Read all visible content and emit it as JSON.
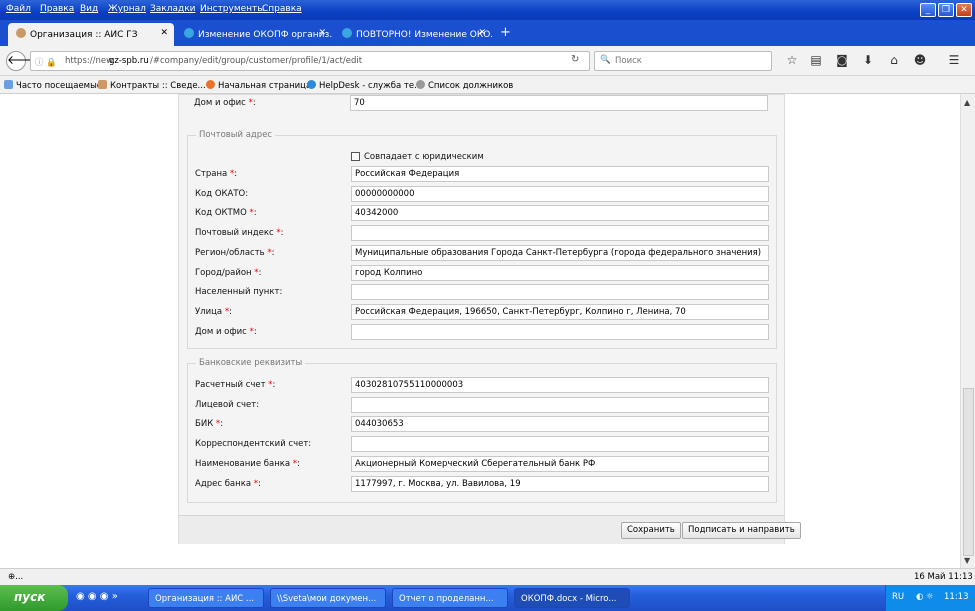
{
  "menu": [
    "Файл",
    "Правка",
    "Вид",
    "Журнал",
    "Закладки",
    "Инструменты",
    "Справка"
  ],
  "tabs": [
    {
      "label": "Организация :: АИС ГЗ",
      "active": true
    },
    {
      "label": "Изменение ОКОПФ организ...",
      "active": false
    },
    {
      "label": "ПОВТОРНО! Изменение ОКО...",
      "active": false
    }
  ],
  "new_tab": "+",
  "url": {
    "prefix": "https://new.",
    "domain": "gz-spb.ru",
    "path": "/#company/edit/group/customer/profile/1/act/edit"
  },
  "search": {
    "placeholder": "Поиск"
  },
  "bookmarks": [
    "Часто посещаемые",
    "Контракты :: Сведе...",
    "Начальная страница",
    "HelpDesk - служба те...",
    "Список должников"
  ],
  "top_row": {
    "label": "Дом и офис",
    "value": "70"
  },
  "postal": {
    "legend": "Почтовый адрес",
    "same_as_legal": "Совпадает с юридическим",
    "fields": [
      {
        "label": "Страна",
        "required": true,
        "value": "Российская Федерация"
      },
      {
        "label": "Код ОКАТО:",
        "required": false,
        "value": "00000000000"
      },
      {
        "label": "Код ОКТМО",
        "required": true,
        "value": "40342000"
      },
      {
        "label": "Почтовый индекс",
        "required": true,
        "value": ""
      },
      {
        "label": "Регион/область",
        "required": true,
        "value": "Муниципальные образования Города Санкт-Петербурга (города федерального значения)"
      },
      {
        "label": "Город/район",
        "required": true,
        "value": "город Колпино"
      },
      {
        "label": "Населенный пункт:",
        "required": false,
        "value": ""
      },
      {
        "label": "Улица",
        "required": true,
        "value": "Российская Федерация, 196650, Санкт-Петербург, Колпино г, Ленина, 70"
      },
      {
        "label": "Дом и офис",
        "required": true,
        "value": ""
      }
    ]
  },
  "bank": {
    "legend": "Банковские реквизиты",
    "fields": [
      {
        "label": "Расчетный счет",
        "required": true,
        "value": "40302810755110000003"
      },
      {
        "label": "Лицевой счет:",
        "required": false,
        "value": ""
      },
      {
        "label": "БИК",
        "required": true,
        "value": "044030653"
      },
      {
        "label": "Корреспондентский счет:",
        "required": false,
        "value": ""
      },
      {
        "label": "Наименование банка",
        "required": true,
        "value": "Акционерный Комерческий Сберегательный банк РФ"
      },
      {
        "label": "Адрес банка",
        "required": true,
        "value": "1177997, г. Москва, ул. Вавилова, 19"
      }
    ]
  },
  "buttons": {
    "save": "Сохранить",
    "sign_send": "Подписать и направить"
  },
  "status": {
    "left": "⊕...",
    "right": "16 Май 11:13"
  },
  "taskbar": {
    "start": "пуск",
    "tasks": [
      "Организация :: АИС ...",
      "\\\\Sveta\\мои докумен...",
      "Отчет о проделанн...",
      "ОКОПФ.docx - Micro..."
    ],
    "lang": "RU",
    "clock": "11:13"
  }
}
